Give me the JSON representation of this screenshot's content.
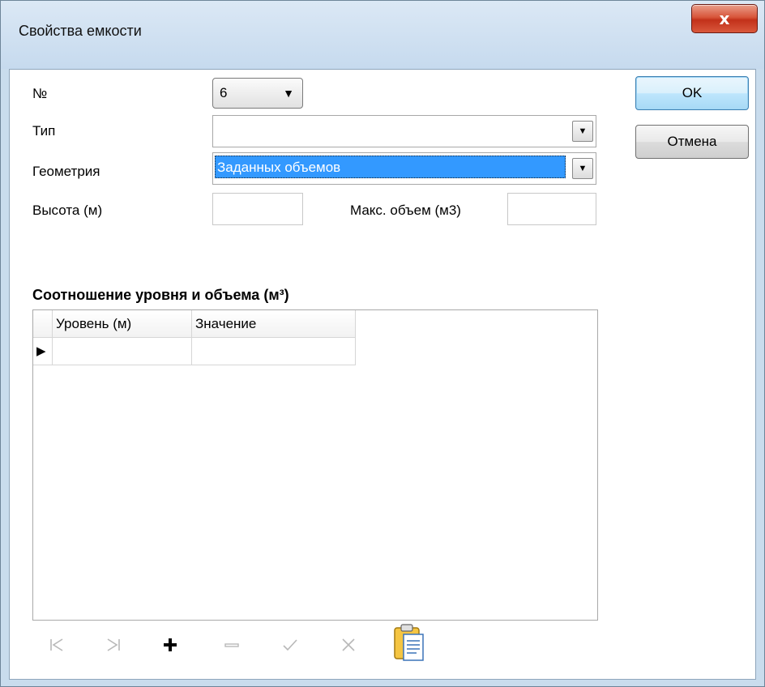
{
  "window": {
    "title": "Свойства емкости",
    "close_symbol": "x"
  },
  "form": {
    "number_label": "№",
    "number_value": "6",
    "type_label": "Тип",
    "type_value": "",
    "geometry_label": "Геометрия",
    "geometry_value": "Заданных объемов",
    "height_label": "Высота (м)",
    "height_value": "",
    "max_volume_label": "Макс. объем (м3)",
    "max_volume_value": ""
  },
  "buttons": {
    "ok_label": "OK",
    "cancel_label": "Отмена"
  },
  "table": {
    "title": "Соотношение уровня и объема (м³)",
    "columns": [
      "Уровень (м)",
      "Значение"
    ],
    "rows": [
      [
        "",
        ""
      ]
    ]
  },
  "navigator": {
    "first_icon": "first-record-icon",
    "last_icon": "last-record-icon",
    "add_icon": "add-record-icon",
    "delete_icon": "delete-record-icon",
    "post_icon": "post-edit-icon",
    "cancel_icon": "cancel-edit-icon",
    "paste_icon": "clipboard-paste-icon"
  }
}
